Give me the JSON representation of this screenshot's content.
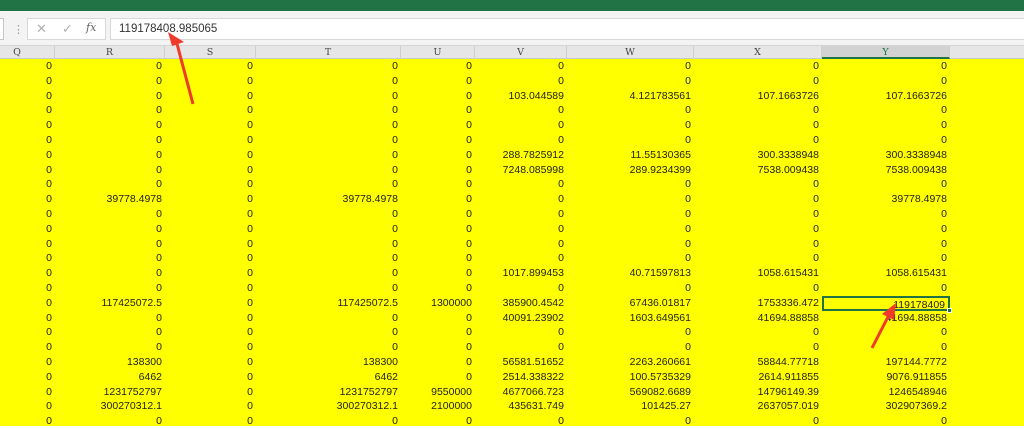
{
  "formula_bar": {
    "cancel_icon": "✕",
    "enter_icon": "✓",
    "fx_label": "fx",
    "value": "119178408.985065"
  },
  "columns": [
    "Q",
    "R",
    "S",
    "T",
    "U",
    "V",
    "W",
    "X",
    "Y"
  ],
  "selected_column": "Y",
  "selected_cell": {
    "row": 16,
    "col": 8
  },
  "accent_color": "#217346",
  "cell_fill": "#ffff00",
  "annotation_color": "#ef3b2c",
  "rows": [
    [
      "0",
      "0",
      "0",
      "0",
      "0",
      "0",
      "0",
      "0",
      "0"
    ],
    [
      "0",
      "0",
      "0",
      "0",
      "0",
      "0",
      "0",
      "0",
      "0"
    ],
    [
      "0",
      "0",
      "0",
      "0",
      "0",
      "103.044589",
      "4.121783561",
      "107.1663726",
      "107.1663726"
    ],
    [
      "0",
      "0",
      "0",
      "0",
      "0",
      "0",
      "0",
      "0",
      "0"
    ],
    [
      "0",
      "0",
      "0",
      "0",
      "0",
      "0",
      "0",
      "0",
      "0"
    ],
    [
      "0",
      "0",
      "0",
      "0",
      "0",
      "0",
      "0",
      "0",
      "0"
    ],
    [
      "0",
      "0",
      "0",
      "0",
      "0",
      "288.7825912",
      "11.55130365",
      "300.3338948",
      "300.3338948"
    ],
    [
      "0",
      "0",
      "0",
      "0",
      "0",
      "7248.085998",
      "289.9234399",
      "7538.009438",
      "7538.009438"
    ],
    [
      "0",
      "0",
      "0",
      "0",
      "0",
      "0",
      "0",
      "0",
      "0"
    ],
    [
      "0",
      "39778.4978",
      "0",
      "39778.4978",
      "0",
      "0",
      "0",
      "0",
      "39778.4978"
    ],
    [
      "0",
      "0",
      "0",
      "0",
      "0",
      "0",
      "0",
      "0",
      "0"
    ],
    [
      "0",
      "0",
      "0",
      "0",
      "0",
      "0",
      "0",
      "0",
      "0"
    ],
    [
      "0",
      "0",
      "0",
      "0",
      "0",
      "0",
      "0",
      "0",
      "0"
    ],
    [
      "0",
      "0",
      "0",
      "0",
      "0",
      "0",
      "0",
      "0",
      "0"
    ],
    [
      "0",
      "0",
      "0",
      "0",
      "0",
      "1017.899453",
      "40.71597813",
      "1058.615431",
      "1058.615431"
    ],
    [
      "0",
      "0",
      "0",
      "0",
      "0",
      "0",
      "0",
      "0",
      "0"
    ],
    [
      "0",
      "117425072.5",
      "0",
      "117425072.5",
      "1300000",
      "385900.4542",
      "67436.01817",
      "1753336.472",
      "119178409"
    ],
    [
      "0",
      "0",
      "0",
      "0",
      "0",
      "40091.23902",
      "1603.649561",
      "41694.88858",
      "41694.88858"
    ],
    [
      "0",
      "0",
      "0",
      "0",
      "0",
      "0",
      "0",
      "0",
      "0"
    ],
    [
      "0",
      "0",
      "0",
      "0",
      "0",
      "0",
      "0",
      "0",
      "0"
    ],
    [
      "0",
      "138300",
      "0",
      "138300",
      "0",
      "56581.51652",
      "2263.260661",
      "58844.77718",
      "197144.7772"
    ],
    [
      "0",
      "6462",
      "0",
      "6462",
      "0",
      "2514.338322",
      "100.5735329",
      "2614.911855",
      "9076.911855"
    ],
    [
      "0",
      "1231752797",
      "0",
      "1231752797",
      "9550000",
      "4677066.723",
      "569082.6689",
      "14796149.39",
      "1246548946"
    ],
    [
      "0",
      "300270312.1",
      "0",
      "300270312.1",
      "2100000",
      "435631.749",
      "101425.27",
      "2637057.019",
      "302907369.2"
    ],
    [
      "0",
      "0",
      "0",
      "0",
      "0",
      "0",
      "0",
      "0",
      "0"
    ]
  ]
}
